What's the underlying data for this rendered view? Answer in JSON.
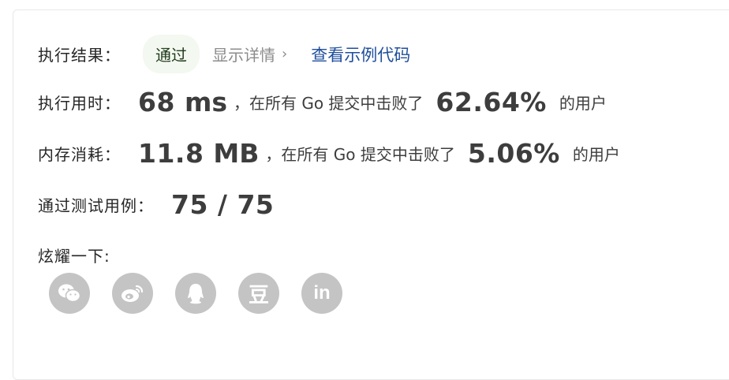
{
  "result": {
    "label": "执行结果：",
    "status": "通过",
    "detail_link": "显示详情",
    "code_link": "查看示例代码"
  },
  "runtime": {
    "label": "执行用时：",
    "value": "68",
    "unit": "ms",
    "text_before": "，在所有 Go 提交中击败了",
    "percent": "62.64%",
    "text_after": "的用户"
  },
  "memory": {
    "label": "内存消耗：",
    "value": "11.8",
    "unit": "MB",
    "text_before": "，在所有 Go 提交中击败了",
    "percent": "5.06%",
    "text_after": "的用户"
  },
  "tests": {
    "label": "通过测试用例：",
    "value": "75 / 75"
  },
  "share": {
    "label": "炫耀一下:",
    "buttons": [
      {
        "icon": "wechat-icon"
      },
      {
        "icon": "weibo-icon"
      },
      {
        "icon": "qq-icon"
      },
      {
        "icon": "douban-icon",
        "glyph": "豆"
      },
      {
        "icon": "linkedin-icon",
        "glyph": "in"
      }
    ]
  },
  "colors": {
    "accent_link": "#1f4f9c",
    "pill_bg": "#f3f8f0",
    "share_icon_bg": "#c4c4c4"
  }
}
